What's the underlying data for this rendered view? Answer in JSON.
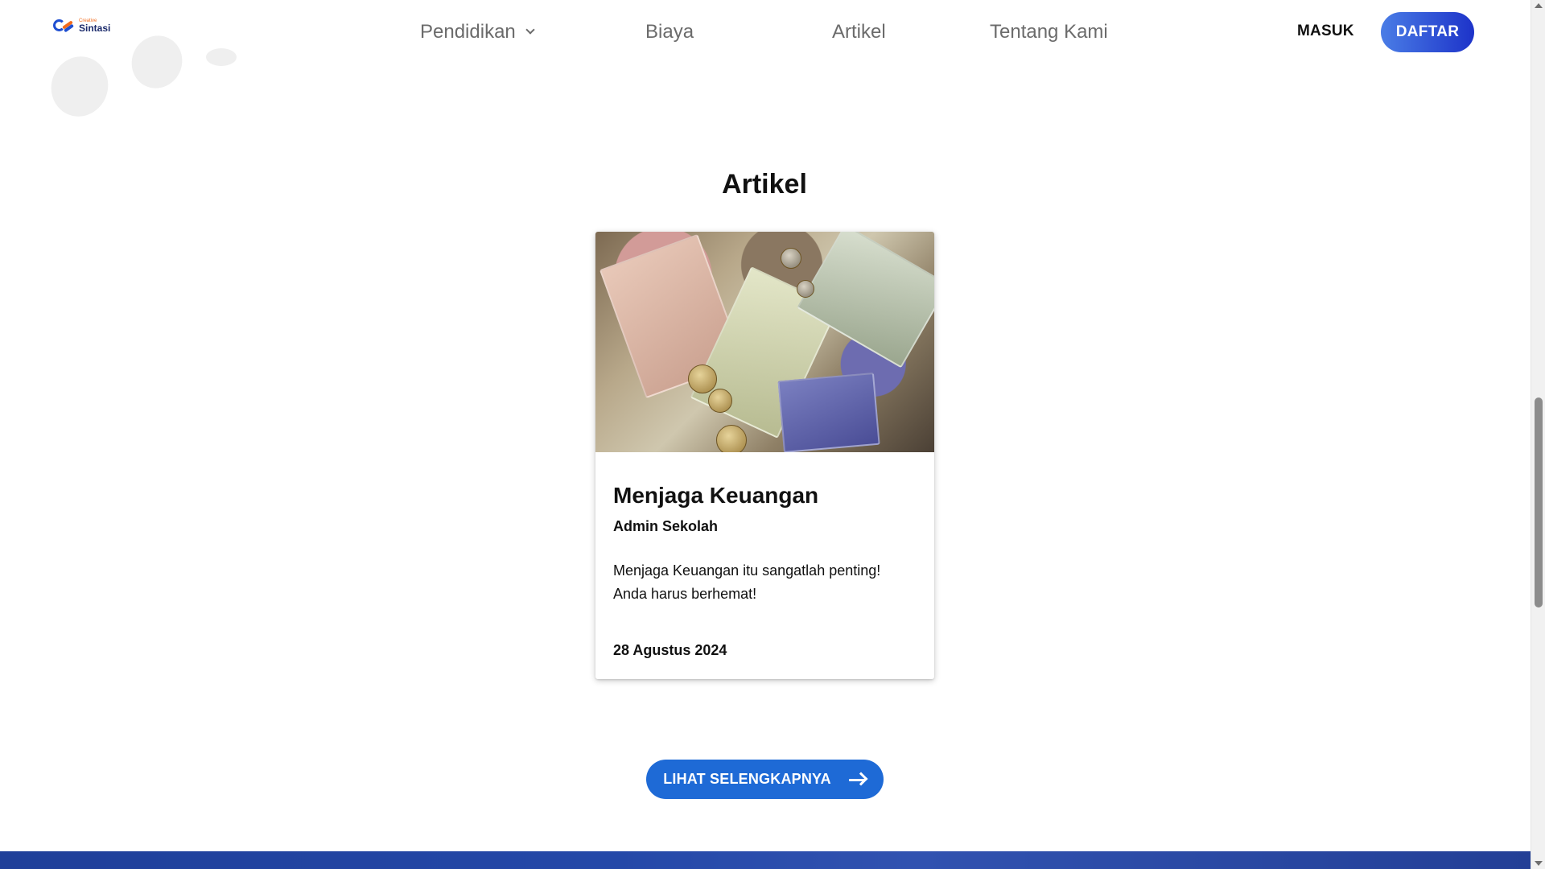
{
  "navbar": {
    "logo": {
      "small": "Creative",
      "big": "Sintasi"
    },
    "links": [
      "Pendidikan",
      "Biaya",
      "Artikel",
      "Tentang Kami"
    ],
    "masuk_label": "MASUK",
    "daftar_label": "DAFTAR"
  },
  "section": {
    "title": "Artikel"
  },
  "article": {
    "title": "Menjaga Keuangan",
    "author": "Admin Sekolah",
    "description": "Menjaga Keuangan itu sangatlah penting! Anda harus berhemat!",
    "date": "28 Agustus 2024"
  },
  "more_button": {
    "label": "LIHAT SELENGKAPNYA"
  },
  "colors": {
    "primary": "#1e6ad6",
    "daftar_gradient_start": "#4a7de6",
    "daftar_gradient_end": "#1d33c9",
    "footer": "#2448a8"
  }
}
